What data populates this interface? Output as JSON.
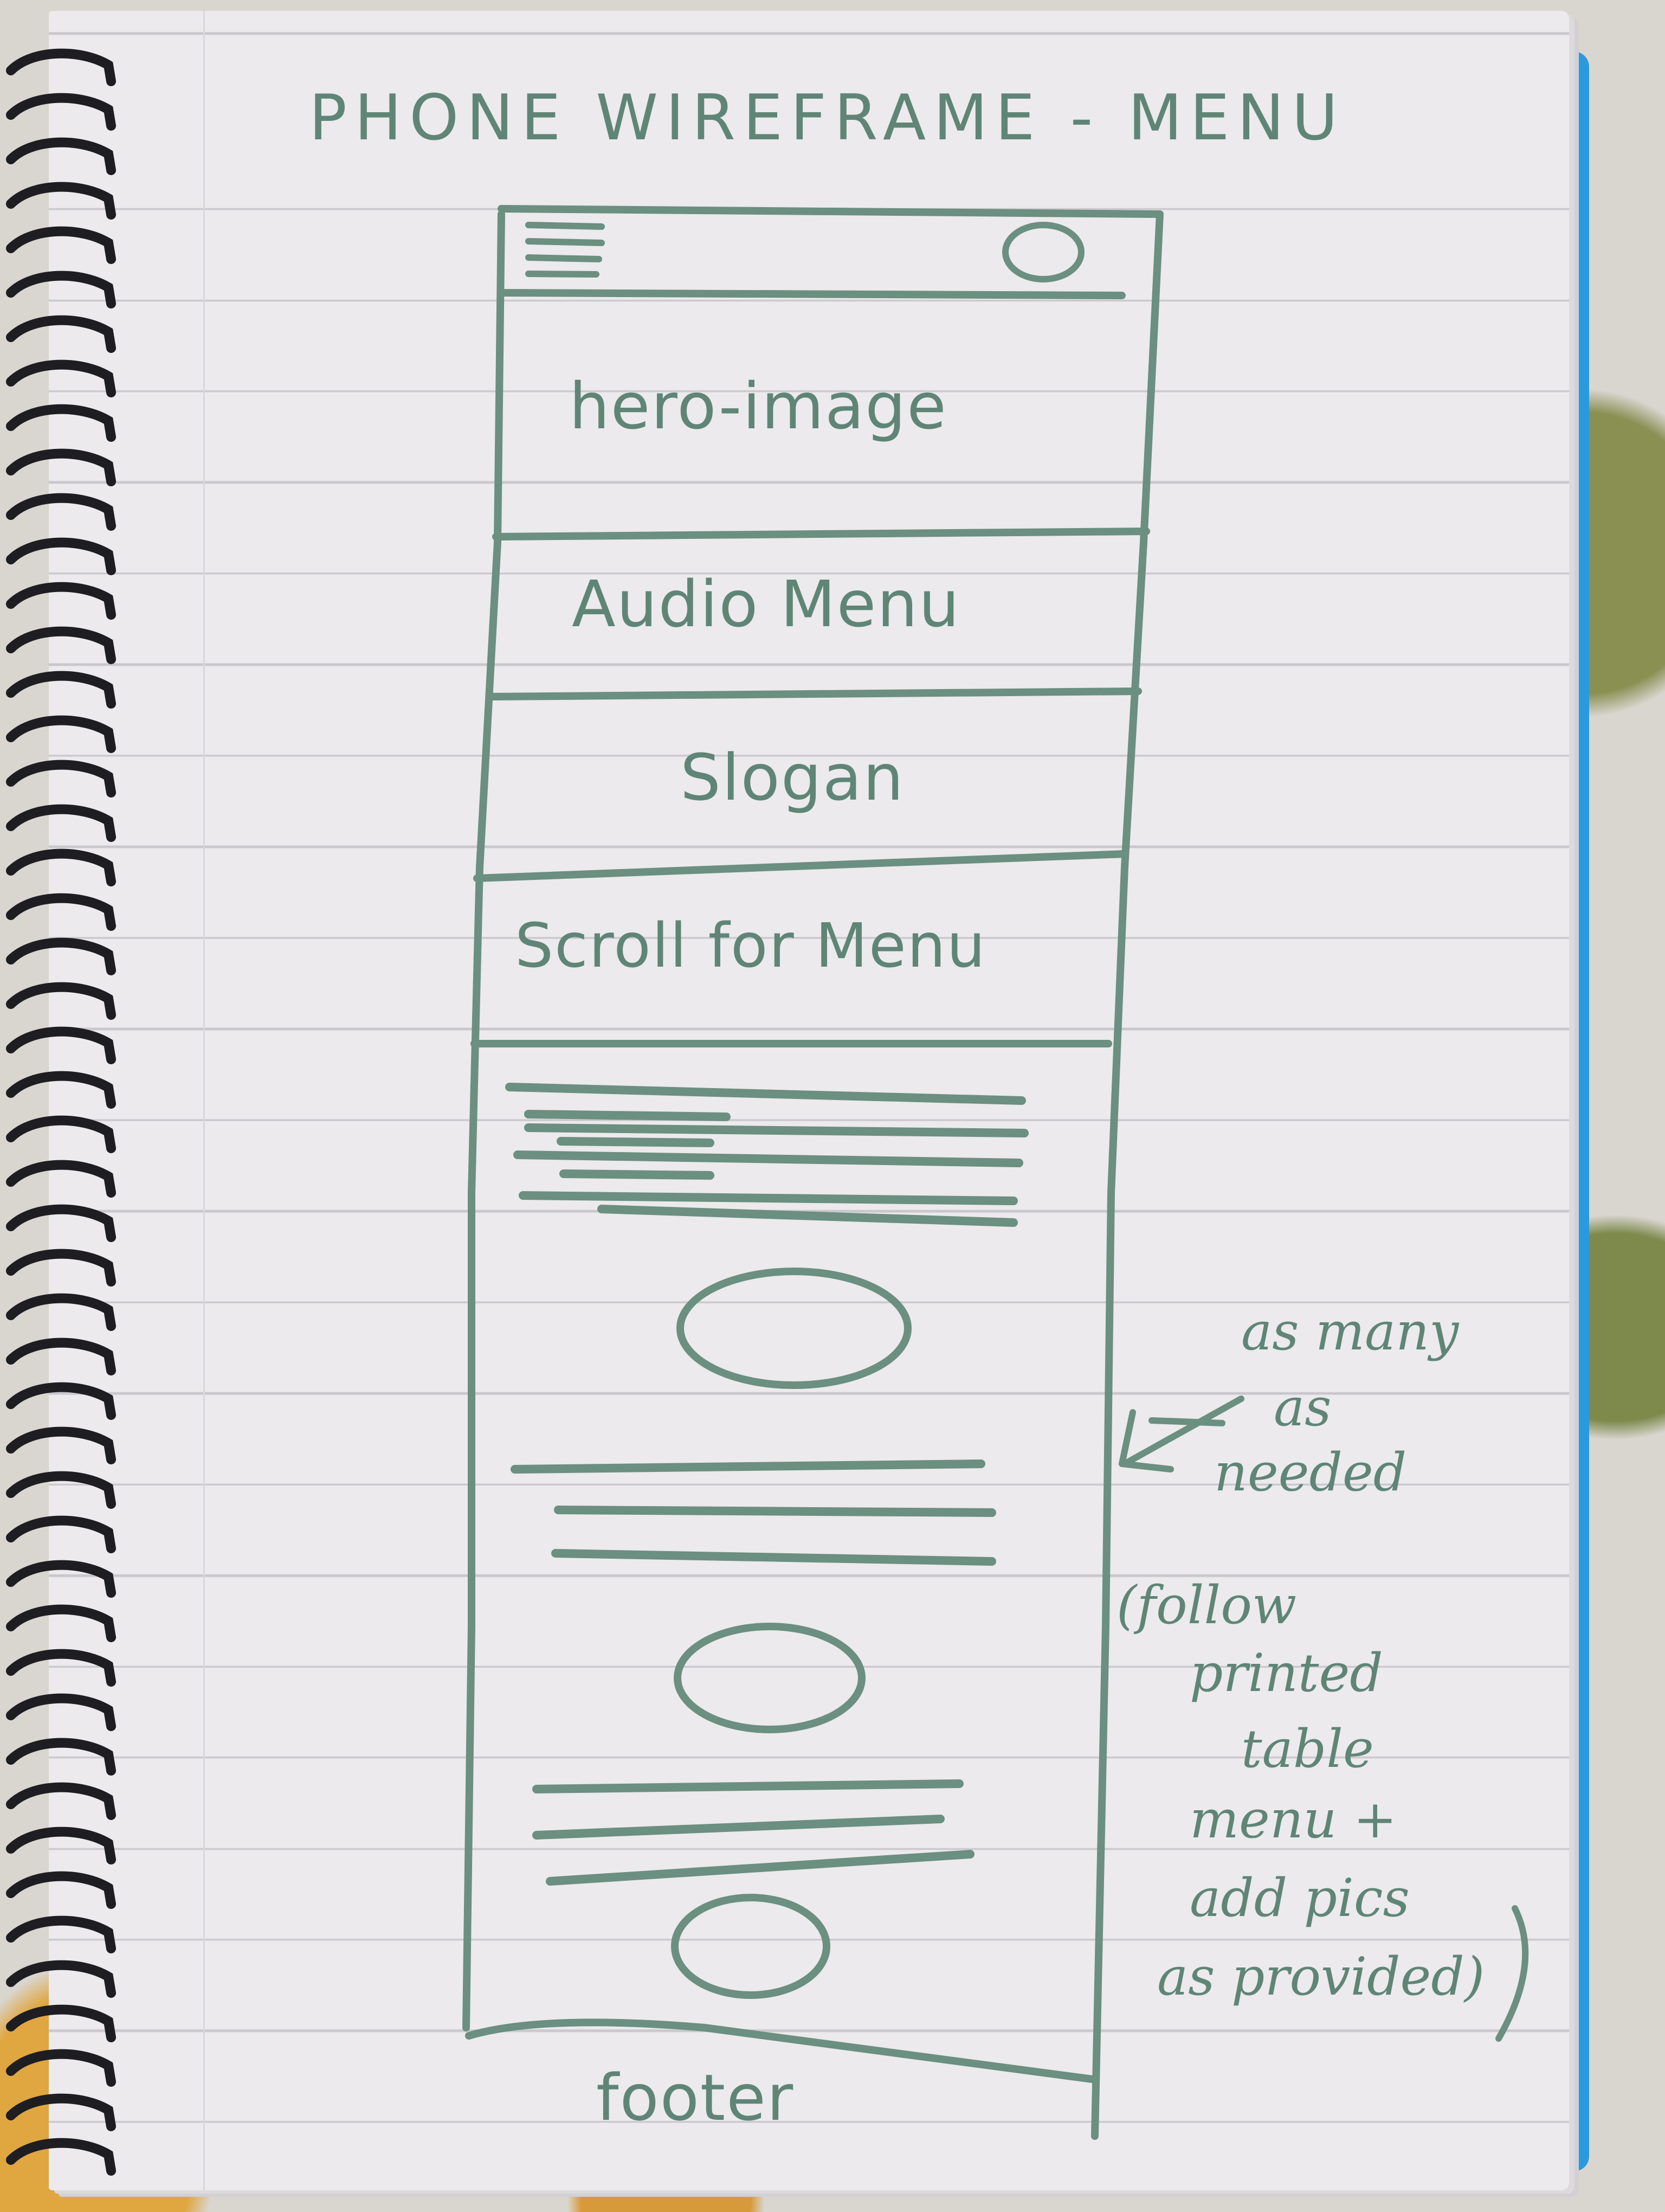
{
  "title": "PHONE WIREFRAME - MENU",
  "sections": {
    "hero": "hero-image",
    "audio": "Audio Menu",
    "slogan": "Slogan",
    "scroll": "Scroll for Menu",
    "footer": "footer"
  },
  "annotation": {
    "line1": "as many",
    "line2": "as",
    "line3": "needed",
    "line4": "(follow",
    "line5": "printed",
    "line6": "table",
    "line7": "menu +",
    "line8": "add pics",
    "line9": "as provided)"
  },
  "colors": {
    "ink": "#5f8576",
    "paper": "#eceaec",
    "notebook_cover": "#2a9ae0"
  },
  "icons": [
    "hamburger-icon",
    "profile-circle-icon",
    "arrow-icon"
  ]
}
